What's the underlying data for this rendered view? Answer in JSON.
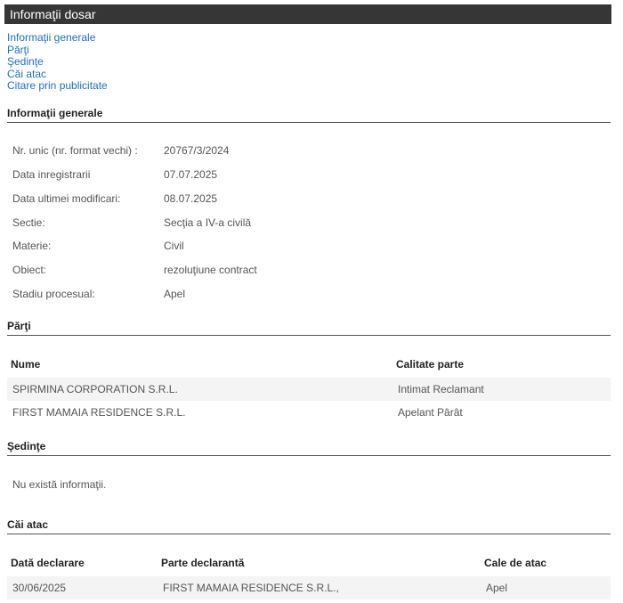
{
  "header": {
    "title": "Informaţii dosar"
  },
  "toc": {
    "items": [
      "Informaţii generale",
      "Părţi",
      "Şedinţe",
      "Căi atac",
      "Citare prin publicitate"
    ]
  },
  "general": {
    "heading": "Informaţii generale",
    "rows": [
      {
        "label": "Nr. unic (nr. format vechi) :",
        "value": "20767/3/2024"
      },
      {
        "label": "Data inregistrarii",
        "value": "07.07.2025"
      },
      {
        "label": "Data ultimei modificari:",
        "value": "08.07.2025"
      },
      {
        "label": "Sectie:",
        "value": "Secţia a IV-a civilă"
      },
      {
        "label": "Materie:",
        "value": "Civil"
      },
      {
        "label": "Obiect:",
        "value": "rezoluţiune contract"
      },
      {
        "label": "Stadiu procesual:",
        "value": "Apel"
      }
    ]
  },
  "parti": {
    "heading": "Părţi",
    "columns": [
      "Nume",
      "Calitate parte"
    ],
    "rows": [
      {
        "nume": "SPIRMINA CORPORATION S.R.L.",
        "calitate": "Intimat Reclamant"
      },
      {
        "nume": "FIRST MAMAIA RESIDENCE S.R.L.",
        "calitate": "Apelant Pârât"
      }
    ]
  },
  "sedinte": {
    "heading": "Şedinţe",
    "empty": "Nu există informaţii."
  },
  "cai_atac": {
    "heading": "Căi atac",
    "columns": [
      "Dată declarare",
      "Parte declarantă",
      "Cale de atac"
    ],
    "rows": [
      {
        "data": "30/06/2025",
        "parte": "FIRST MAMAIA RESIDENCE S.R.L.,",
        "cale": "Apel"
      }
    ]
  }
}
